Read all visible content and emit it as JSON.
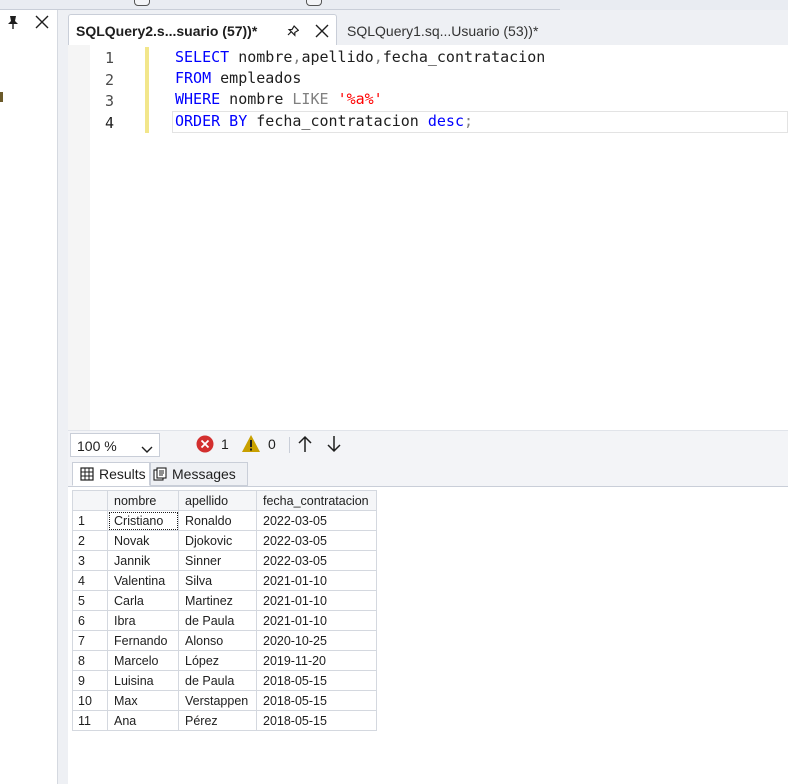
{
  "tabs": {
    "active": "SQLQuery2.s...suario (57))*",
    "inactive": "SQLQuery1.sq...Usuario (53))*"
  },
  "editor": {
    "line_numbers": [
      "1",
      "2",
      "3",
      "4"
    ],
    "lines": [
      {
        "kw1": "SELECT",
        "t1": " nombre",
        "s1": ",",
        "t2": "apellido",
        "s2": ",",
        "t3": "fecha_contratacion"
      },
      {
        "kw1": "FROM",
        "t1": " empleados"
      },
      {
        "kw1": "WHERE",
        "t1": " nombre ",
        "kw2": "LIKE",
        "t2": " ",
        "str": "'%a%'"
      },
      {
        "kw1": "ORDER BY",
        "t1": " fecha_contratacion ",
        "kw2": "desc",
        "s1": ";"
      }
    ]
  },
  "status": {
    "zoom": "100 %",
    "errors": "1",
    "warnings": "0"
  },
  "results_tabs": {
    "results": "Results",
    "messages": "Messages"
  },
  "grid": {
    "columns": [
      "nombre",
      "apellido",
      "fecha_contratacion"
    ],
    "rows": [
      {
        "n": "1",
        "nombre": "Cristiano",
        "apellido": "Ronaldo",
        "fecha": "2022-03-05"
      },
      {
        "n": "2",
        "nombre": "Novak",
        "apellido": "Djokovic",
        "fecha": "2022-03-05"
      },
      {
        "n": "3",
        "nombre": "Jannik",
        "apellido": "Sinner",
        "fecha": "2022-03-05"
      },
      {
        "n": "4",
        "nombre": "Valentina",
        "apellido": "Silva",
        "fecha": "2021-01-10"
      },
      {
        "n": "5",
        "nombre": "Carla",
        "apellido": "Martinez",
        "fecha": "2021-01-10"
      },
      {
        "n": "6",
        "nombre": "Ibra",
        "apellido": "de Paula",
        "fecha": "2021-01-10"
      },
      {
        "n": "7",
        "nombre": "Fernando",
        "apellido": "Alonso",
        "fecha": "2020-10-25"
      },
      {
        "n": "8",
        "nombre": "Marcelo",
        "apellido": "López",
        "fecha": "2019-11-20"
      },
      {
        "n": "9",
        "nombre": "Luisina",
        "apellido": "de Paula",
        "fecha": "2018-05-15"
      },
      {
        "n": "10",
        "nombre": "Max",
        "apellido": "Verstappen",
        "fecha": "2018-05-15"
      },
      {
        "n": "11",
        "nombre": "Ana",
        "apellido": "Pérez",
        "fecha": "2018-05-15"
      }
    ]
  },
  "icons": {
    "pin": "pin-icon",
    "close": "close-icon",
    "error": "error-icon",
    "warning": "warning-icon",
    "results": "grid-icon",
    "messages": "messages-icon"
  },
  "colors": {
    "keyword": "#0000ff",
    "keyword_gray": "#808080",
    "string": "#ff0000",
    "error": "#d32f2f",
    "warning": "#c8a000"
  }
}
